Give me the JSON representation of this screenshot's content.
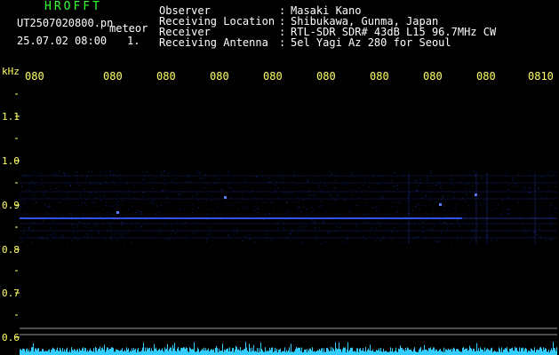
{
  "header": {
    "logo": "HROFFT",
    "filename": "UT2507020800.pn",
    "mode": "meteor",
    "datetime": "25.07.02 08:00",
    "counter": "1.",
    "info_labels": [
      "Observer",
      "Receiving Location",
      "Receiver",
      "Receiving Antenna"
    ],
    "info_colons": [
      ":",
      ":",
      ":",
      ":"
    ],
    "info_values": [
      "Masaki Kano",
      "Shibukawa, Gunma, Japan",
      "RTL-SDR SDR# 43dB L15 96.7MHz CW",
      "5el Yagi Az 280 for Seoul"
    ]
  },
  "axis": {
    "unit": "kHz",
    "y_ticks": [
      "1.1",
      "1.0",
      "0.9",
      "0.8",
      "0.7",
      "0.6"
    ],
    "x_ticks": [
      "080",
      "080",
      "080",
      "080",
      "080",
      "080",
      "080",
      "080",
      "080",
      "0810"
    ]
  },
  "colors": {
    "background": "#000000",
    "text_yellow": "#ffff66",
    "text_white": "#ffffff",
    "logo_green": "#33ff33",
    "signal_blue": "#3b5bff",
    "noise_cyan": "#33ccff",
    "marker_gray": "#9a9a9a"
  }
}
